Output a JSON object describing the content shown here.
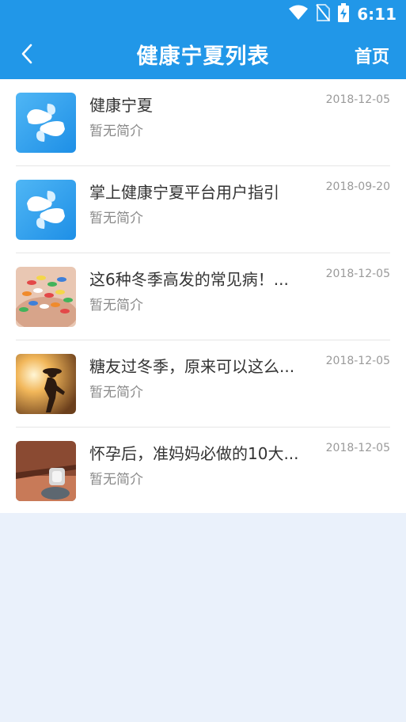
{
  "status_bar": {
    "time": "6:11",
    "icons": [
      "wifi-icon",
      "no-sim-icon",
      "battery-charging-icon"
    ]
  },
  "header": {
    "back_icon": "chevron-left-icon",
    "title": "健康宁夏列表",
    "home_label": "首页"
  },
  "colors": {
    "primary": "#2197e8",
    "background": "#eaf1fb"
  },
  "items": [
    {
      "title": "健康宁夏",
      "desc": "暂无简介",
      "date": "2018-12-05",
      "thumb": "health-app-logo"
    },
    {
      "title": "掌上健康宁夏平台用户指引",
      "desc": "暂无简介",
      "date": "2018-09-20",
      "thumb": "health-app-logo"
    },
    {
      "title": "这6种冬季高发的常见病！...",
      "desc": "暂无简介",
      "date": "2018-12-05",
      "thumb": "pills-photo"
    },
    {
      "title": "糖友过冬季，原来可以这么...",
      "desc": "暂无简介",
      "date": "2018-12-05",
      "thumb": "runner-photo"
    },
    {
      "title": "怀孕后，准妈妈必做的10大...",
      "desc": "暂无简介",
      "date": "2018-12-05",
      "thumb": "furniture-corner-photo"
    }
  ]
}
